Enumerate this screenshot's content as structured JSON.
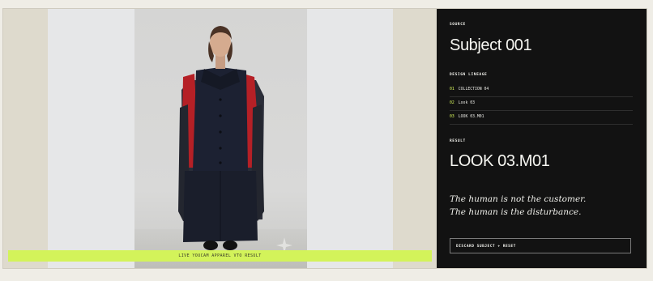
{
  "vto": {
    "result_bar_label": "LIVE YOUCAM APPAREL VTO RESULT"
  },
  "sidebar": {
    "source_label": "SOURCE",
    "subject_title": "Subject 001",
    "lineage_label": "DESIGN LINEAGE",
    "lineage": [
      {
        "num": "01",
        "name": "COLLECTION 04"
      },
      {
        "num": "02",
        "name": "Look 03"
      },
      {
        "num": "03",
        "name": "LOOK 03.M01"
      }
    ],
    "result_label": "RESULT",
    "result_title": "LOOK 03.M01",
    "quote_line1": "The human is not the customer.",
    "quote_line2": "The human is the disturbance.",
    "discard_label": "DISCARD SUBJECT + RESET"
  },
  "colors": {
    "accent": "#d3f35a",
    "panel_dark": "#121212",
    "coat_navy": "#1c2132",
    "sleeve_red": "#b52026"
  }
}
